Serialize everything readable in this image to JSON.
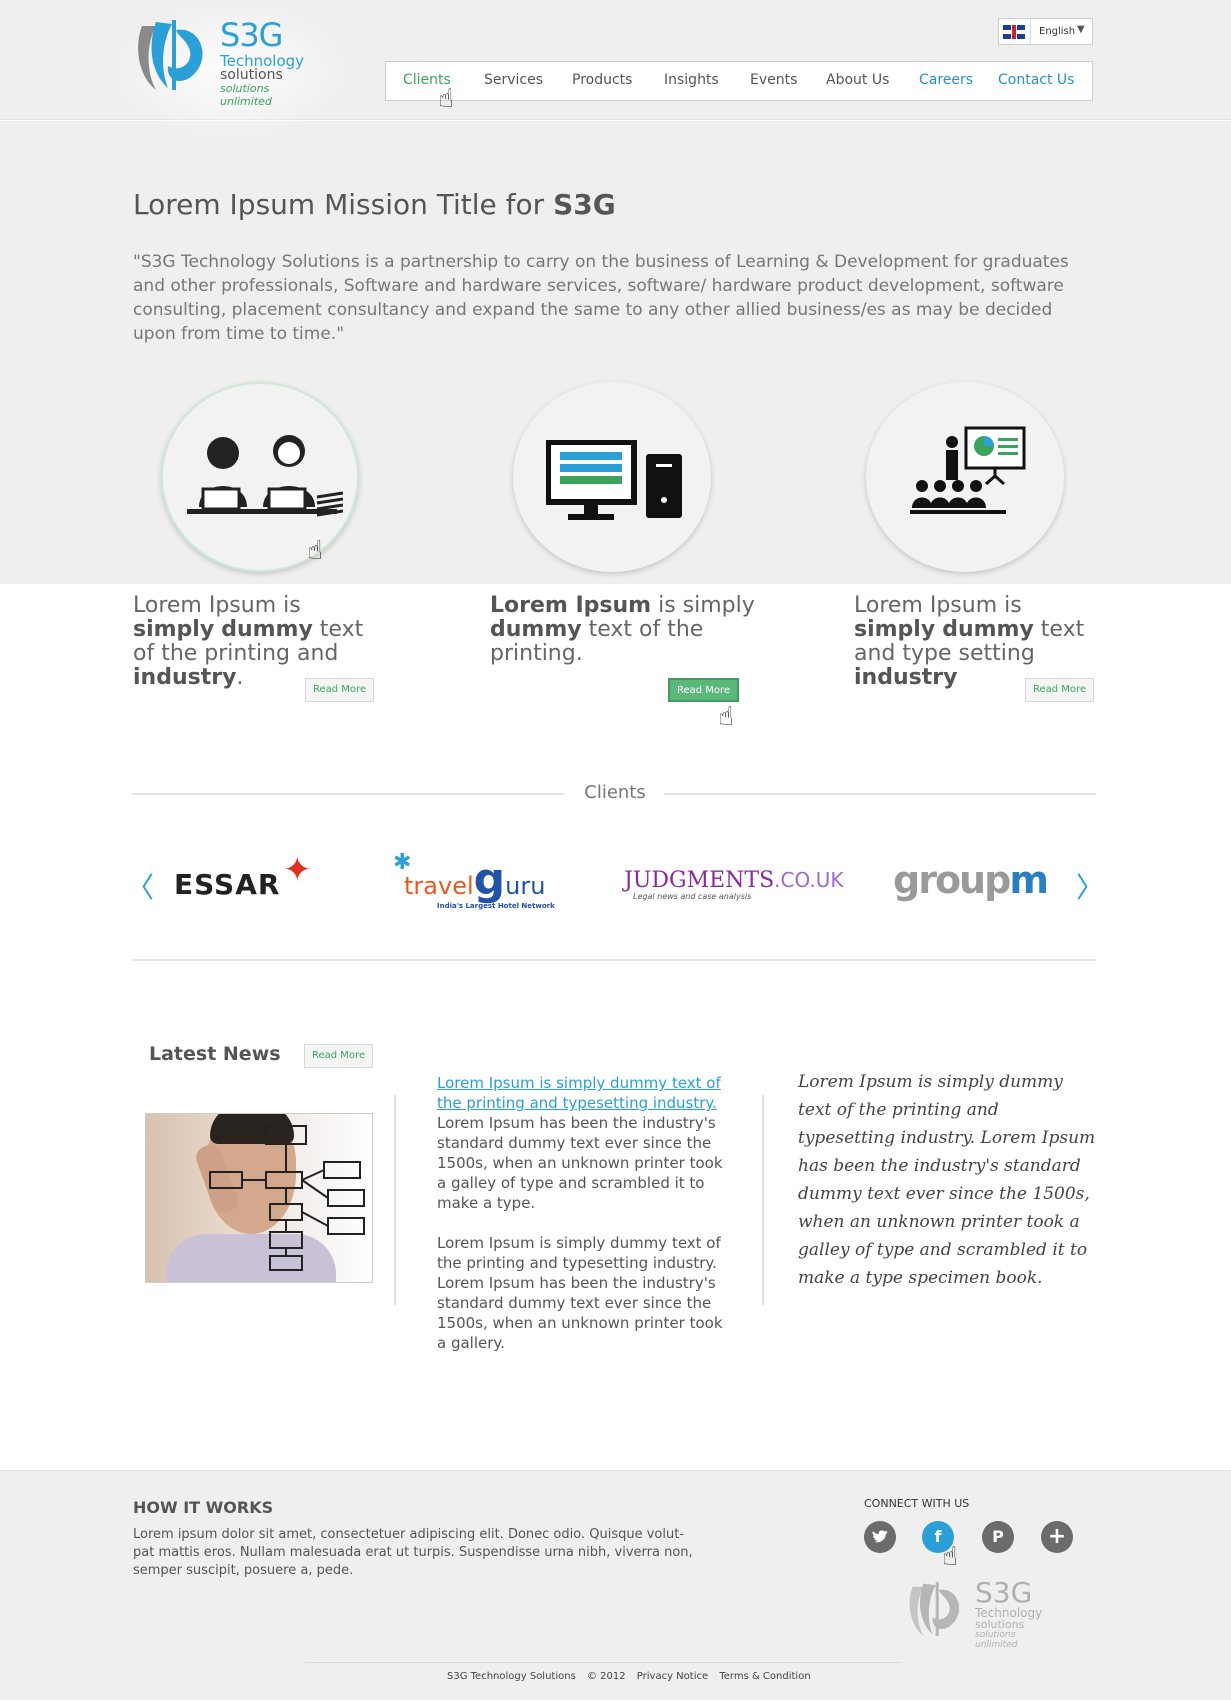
{
  "header": {
    "logo": {
      "name": "S3G",
      "line1": "Technology",
      "line2": "solutions",
      "line3": "solutions unlimited"
    },
    "language": "English",
    "nav": [
      "Clients",
      "Services",
      "Products",
      "Insights",
      "Events",
      "About Us",
      "Careers",
      "Contact Us"
    ]
  },
  "mission": {
    "title_prefix": "Lorem Ipsum Mission Title for ",
    "title_bold": "S3G",
    "text": "\"S3G Technology Solutions is a partnership to carry on the business of Learning & Development for graduates and other professionals, Software and hardware services, software/ hardware product development, software consulting, placement consultancy and expand the same to any other allied business/es as may be decided upon from time to time.\""
  },
  "features": [
    {
      "icon": "people-laptop-icon",
      "t1": "Lorem Ipsum is ",
      "b1": "simply",
      "t2": "",
      "b2": "dummy",
      "t3": " text of the printing and  ",
      "b3": "industry",
      "t4": ".",
      "button": "Read More"
    },
    {
      "icon": "computer-icon",
      "t1": "",
      "b1": "Lorem Ipsum",
      "t2": " is simply ",
      "b2": "dummy",
      "t3": " text of the printing.",
      "b3": "",
      "t4": "",
      "button": "Read More"
    },
    {
      "icon": "presentation-icon",
      "t1": "Lorem Ipsum is ",
      "b1": "simply",
      "t2": "",
      "b2": "dummy",
      "t3": " text and type setting ",
      "b3": "industry",
      "t4": "",
      "button": "Read More"
    }
  ],
  "clients": {
    "title": "Clients",
    "prev_arrow": "〈",
    "next_arrow": "〉",
    "logos": {
      "essar": "ESSAR",
      "travelguru": {
        "travel": "travel",
        "g": "g",
        "uru": "uru",
        "sub": "India's Largest Hotel Network"
      },
      "judgments": {
        "main": "JUDGMENTS",
        "co": ".CO.UK",
        "sub": "Legal news and case analysis"
      },
      "groupm": {
        "group": "group",
        "m": "m"
      }
    }
  },
  "news": {
    "title": "Latest News",
    "button": "Read More",
    "link": "Lorem Ipsum is simply dummy text of the printing and typesetting industry.",
    "body1": "Lorem Ipsum has been the industry's standard dummy text ever since the 1500s, when an unknown printer took a galley of type and scrambled it to make a type.",
    "body2": "Lorem Ipsum is simply dummy text of the printing and typesetting industry. Lorem Ipsum has been the industry's standard dummy text ever since the 1500s, when an unknown printer took a gallery.",
    "script": "Lorem Ipsum is simply dummy text of the printing and typesetting industry. Lorem Ipsum has been the industry's standard dummy text ever since the 1500s, when an unknown printer took a galley of type and scrambled it to make a type specimen book."
  },
  "footer": {
    "how_title": "HOW IT WORKS",
    "how_text": "Lorem ipsum dolor sit amet, consectetuer adipiscing elit. Donec odio. Quisque volut-pat mattis eros. Nullam malesuada erat ut turpis. Suspendisse urna nibh, viverra non, semper suscipit, posuere a, pede.",
    "connect": "CONNECT WITH US",
    "social": [
      "twitter-icon",
      "facebook-icon",
      "pinterest-icon",
      "plus-icon"
    ],
    "social_glyphs": {
      "plus": "+",
      "fb": "f",
      "pin": "P"
    },
    "logo": {
      "name": "S3G",
      "line1": "Technology",
      "line2": "solutions",
      "line3": "solutions unlimited"
    },
    "links": [
      "S3G Technology Solutions",
      "© 2012",
      "Privacy Notice",
      "Terms & Condition"
    ]
  },
  "colors": {
    "accent_green": "#3aa55a",
    "accent_blue": "#2a9fd8",
    "bg_grey": "#efefef"
  }
}
